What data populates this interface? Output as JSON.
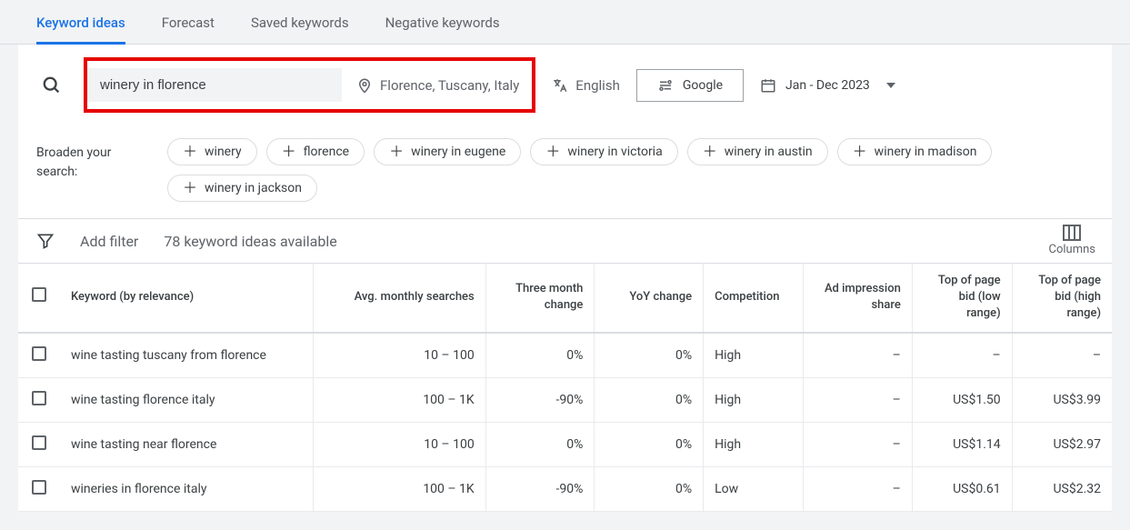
{
  "tabs": {
    "keyword_ideas": "Keyword ideas",
    "forecast": "Forecast",
    "saved": "Saved keywords",
    "negative": "Negative keywords"
  },
  "filters": {
    "search_value": "winery in florence",
    "location": "Florence, Tuscany, Italy",
    "language": "English",
    "network": "Google",
    "date_range": "Jan - Dec 2023"
  },
  "broaden": {
    "label": "Broaden your search:",
    "chips": [
      "winery",
      "florence",
      "winery in eugene",
      "winery in victoria",
      "winery in austin",
      "winery in madison",
      "winery in jackson"
    ]
  },
  "toolbar": {
    "add_filter": "Add filter",
    "ideas_available": "78 keyword ideas available",
    "columns_label": "Columns"
  },
  "table": {
    "headers": {
      "keyword": "Keyword (by relevance)",
      "avg_searches": "Avg. monthly searches",
      "three_month": "Three month change",
      "yoy": "YoY change",
      "competition": "Competition",
      "ad_impression": "Ad impression share",
      "bid_low": "Top of page bid (low range)",
      "bid_high": "Top of page bid (high range)"
    },
    "rows": [
      {
        "keyword": "wine tasting tuscany from florence",
        "avg": "10 – 100",
        "three_month": "0%",
        "yoy": "0%",
        "competition": "High",
        "ad_impression": "–",
        "bid_low": "–",
        "bid_high": "–"
      },
      {
        "keyword": "wine tasting florence italy",
        "avg": "100 – 1K",
        "three_month": "-90%",
        "yoy": "0%",
        "competition": "High",
        "ad_impression": "–",
        "bid_low": "US$1.50",
        "bid_high": "US$3.99"
      },
      {
        "keyword": "wine tasting near florence",
        "avg": "10 – 100",
        "three_month": "0%",
        "yoy": "0%",
        "competition": "High",
        "ad_impression": "–",
        "bid_low": "US$1.14",
        "bid_high": "US$2.97"
      },
      {
        "keyword": "wineries in florence italy",
        "avg": "100 – 1K",
        "three_month": "-90%",
        "yoy": "0%",
        "competition": "Low",
        "ad_impression": "–",
        "bid_low": "US$0.61",
        "bid_high": "US$2.32"
      }
    ]
  }
}
